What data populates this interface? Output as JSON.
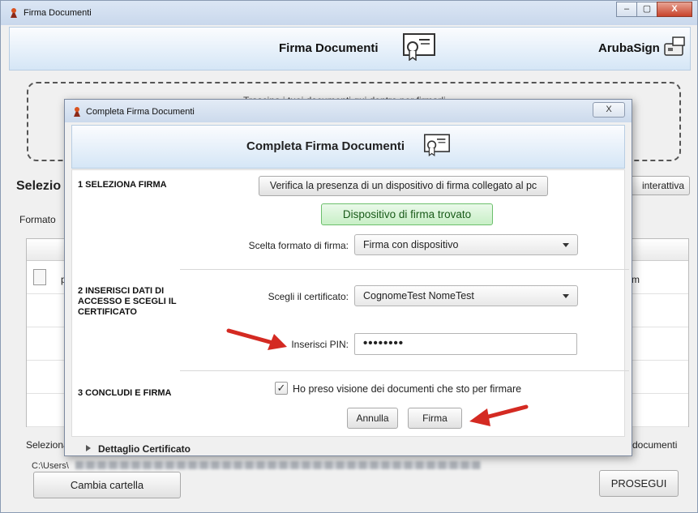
{
  "main_window": {
    "title": "Firma Documenti",
    "header_title": "Firma Documenti",
    "brand": "ArubaSign",
    "drop_text": "Trascina i tuoi documenti qui dentro per firmarli",
    "section_title": "Selezio",
    "format_label": "Formato",
    "interactive_button": "interattiva",
    "row_prefix": "p",
    "row_suffix": "m",
    "select_label": "Seleziona",
    "documents_label": "documenti",
    "path_prefix": "C:\\Users\\",
    "change_folder_button": "Cambia cartella",
    "proceed_button": "PROSEGUI",
    "window_buttons": [
      "–",
      "▢",
      "X"
    ]
  },
  "dialog": {
    "title": "Completa Firma Documenti",
    "header_title": "Completa Firma Documenti",
    "close_button": "X",
    "step1": "1 SELEZIONA FIRMA",
    "verify_button": "Verifica la presenza di un dispositivo di firma collegato al pc",
    "device_found": "Dispositivo di firma trovato",
    "format_label": "Scelta formato di firma:",
    "format_value": "Firma con dispositivo",
    "step2": "2 INSERISCI DATI DI ACCESSO E SCEGLI IL CERTIFICATO",
    "cert_label": "Scegli il certificato:",
    "cert_value": "CognomeTest NomeTest",
    "pin_label": "Inserisci PIN:",
    "pin_value": "••••••••",
    "step3": "3 CONCLUDI E FIRMA",
    "ack_checked": true,
    "ack_label": "Ho preso visione dei documenti che sto per firmare",
    "cancel_button": "Annulla",
    "sign_button": "Firma",
    "details_toggle": "Dettaglio Certificato"
  },
  "colors": {
    "arrow": "#d42a22",
    "found_bg": "#d7f4d5",
    "found_border": "#6cbf6c"
  }
}
